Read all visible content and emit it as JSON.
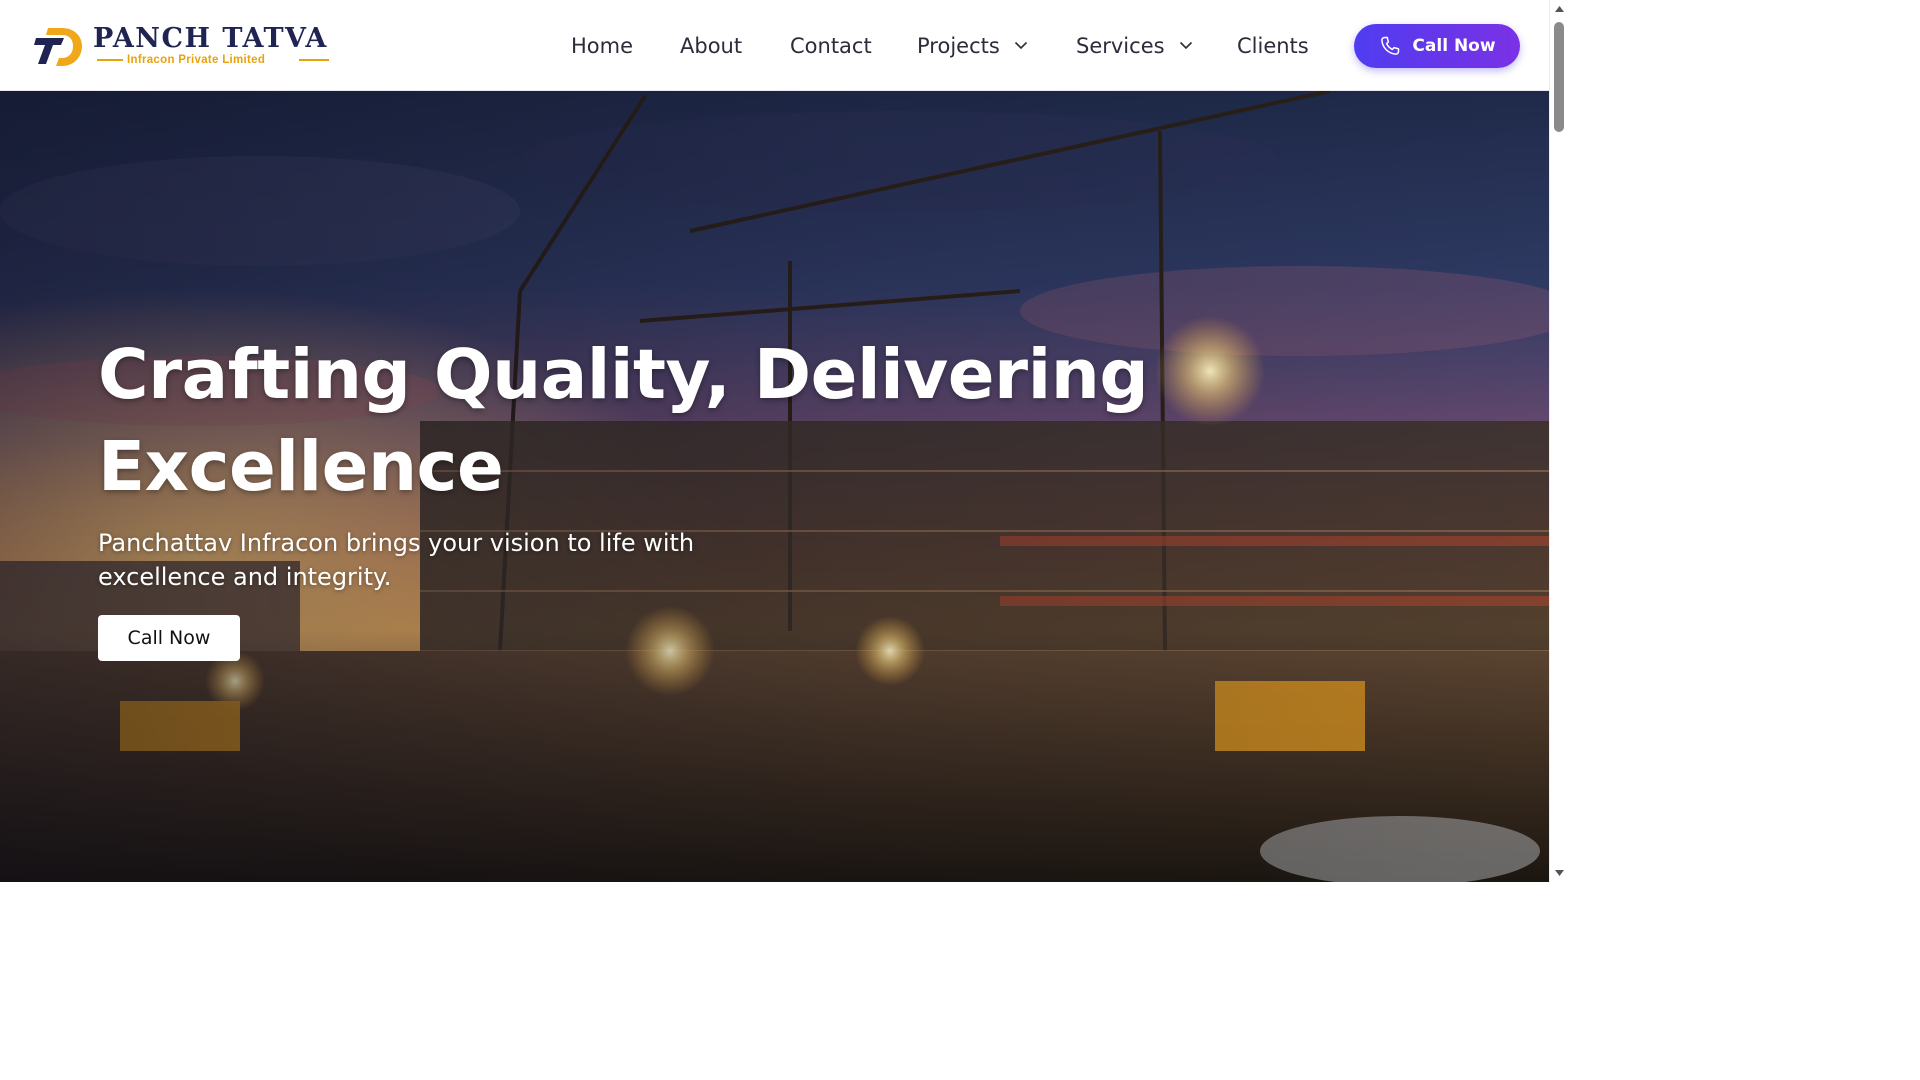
{
  "header": {
    "logo": {
      "name": "PANCH TATVA",
      "subtitle": "Infracon Private Limited",
      "colors": {
        "navy": "#1f2452",
        "gold": "#e8a20c"
      }
    },
    "nav": [
      {
        "label": "Home",
        "has_dropdown": false
      },
      {
        "label": "About",
        "has_dropdown": false
      },
      {
        "label": "Contact",
        "has_dropdown": false
      },
      {
        "label": "Projects",
        "has_dropdown": true
      },
      {
        "label": "Services",
        "has_dropdown": true
      },
      {
        "label": "Clients",
        "has_dropdown": false
      }
    ],
    "call_button": {
      "label": "Call Now",
      "icon": "phone-icon",
      "color": "#5b3aee"
    }
  },
  "hero": {
    "title": "Crafting Quality, Delivering Excellence",
    "subtitle": "Panchattav Infracon brings your vision to life with excellence and integrity.",
    "button_label": "Call Now",
    "background": "construction-site-at-dusk"
  }
}
